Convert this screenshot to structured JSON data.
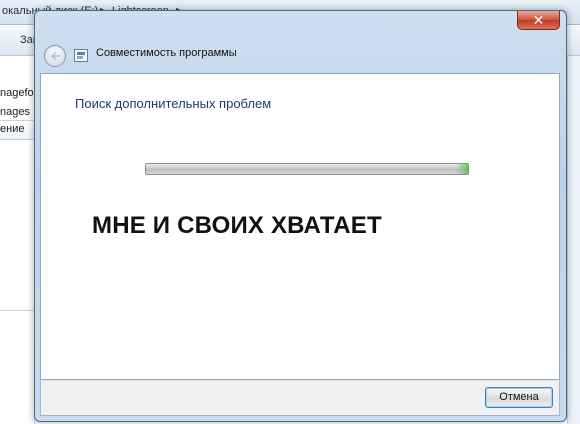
{
  "background_explorer": {
    "breadcrumbs": [
      "окальный диск (E:)",
      "Lightscreen"
    ],
    "toolbar_item": "Зап",
    "files": [
      "nagefor",
      "nages",
      "ение"
    ]
  },
  "dialog": {
    "title": "Совместимость программы",
    "close_glyph": "✕",
    "heading": "Поиск дополнительных проблем",
    "progress_percent": 100,
    "caption": "МНЕ И СВОИХ ХВАТАЕТ",
    "cancel_label": "Отмена"
  },
  "colors": {
    "heading": "#1e3a66",
    "close_button": "#c13a22",
    "title_bar": "#bcd2ea"
  },
  "icons": [
    "back-arrow-icon",
    "program-compatibility-icon",
    "close-icon"
  ]
}
